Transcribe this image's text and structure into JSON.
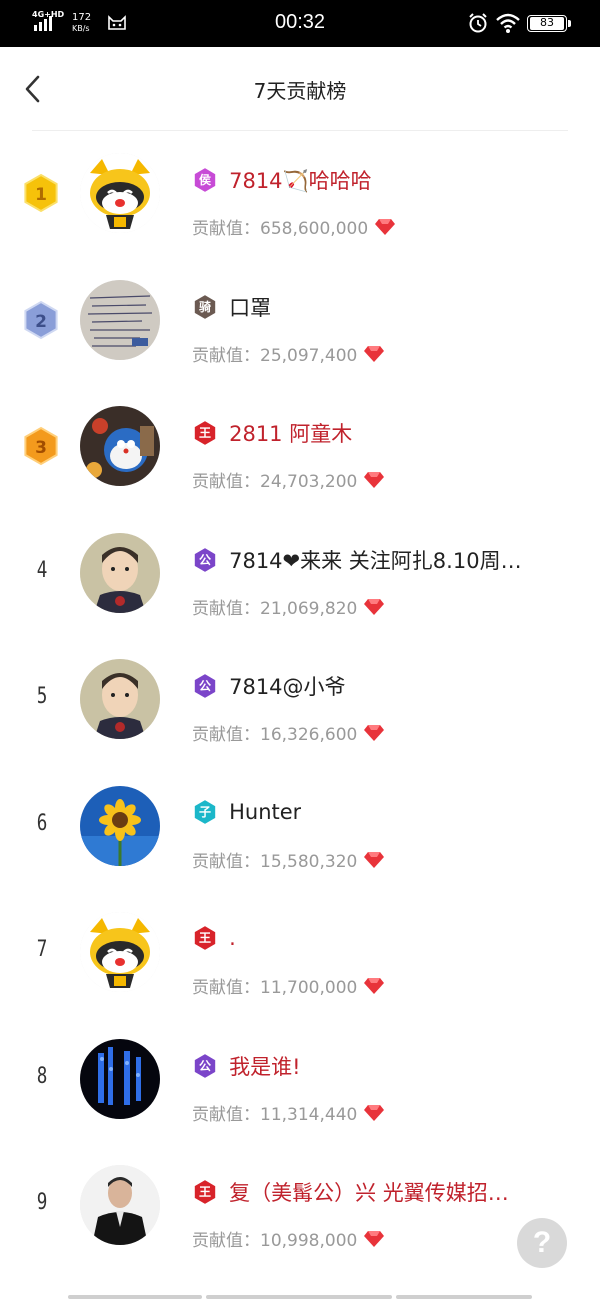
{
  "status_bar": {
    "network": "4G+HD",
    "speed_value": "172",
    "speed_unit": "KB/s",
    "time": "00:32",
    "battery": "83",
    "icons": [
      "signal-icon",
      "cat-icon",
      "alarm-icon",
      "wifi-icon",
      "battery-icon"
    ]
  },
  "header": {
    "title": "7天贡献榜",
    "back_icon": "chevron-left-icon"
  },
  "contribution_label": "贡献值：",
  "rankings": [
    {
      "rank": "1",
      "medal": "gold",
      "badge": "侯",
      "badge_color": "#c74bd6",
      "name": "7814🏹哈哈哈",
      "vip": true,
      "value": "658,600,000"
    },
    {
      "rank": "2",
      "medal": "silver",
      "badge": "骑",
      "badge_color": "#6b5a52",
      "name": "口罩",
      "vip": false,
      "value": "25,097,400"
    },
    {
      "rank": "3",
      "medal": "bronze",
      "badge": "王",
      "badge_color": "#d8232a",
      "name": "2811 阿童木",
      "vip": true,
      "value": "24,703,200"
    },
    {
      "rank": "4",
      "medal": "",
      "badge": "公",
      "badge_color": "#7b45c9",
      "name": "7814❤来来 关注阿扎8.10周…",
      "vip": false,
      "value": "21,069,820"
    },
    {
      "rank": "5",
      "medal": "",
      "badge": "公",
      "badge_color": "#7b45c9",
      "name": "7814@小爷",
      "vip": false,
      "value": "16,326,600"
    },
    {
      "rank": "6",
      "medal": "",
      "badge": "子",
      "badge_color": "#1bb7c9",
      "name": "Hunter",
      "vip": false,
      "value": "15,580,320"
    },
    {
      "rank": "7",
      "medal": "",
      "badge": "王",
      "badge_color": "#d8232a",
      "name": ".",
      "vip": true,
      "value": "11,700,000"
    },
    {
      "rank": "8",
      "medal": "",
      "badge": "公",
      "badge_color": "#7b45c9",
      "name": "我是谁!",
      "vip": true,
      "value": "11,314,440"
    },
    {
      "rank": "9",
      "medal": "",
      "badge": "王",
      "badge_color": "#d8232a",
      "name": "复（美髯公）兴 光翼传媒招…",
      "vip": true,
      "value": "10,998,000"
    }
  ],
  "colors": {
    "vip_name": "#c0222c",
    "normal_name": "#222222",
    "muted": "#999999",
    "gem": "#e8333a",
    "gold": "#f6c20a",
    "silver": "#8a9ed8",
    "bronze": "#f39a1d"
  },
  "help_button": "?"
}
